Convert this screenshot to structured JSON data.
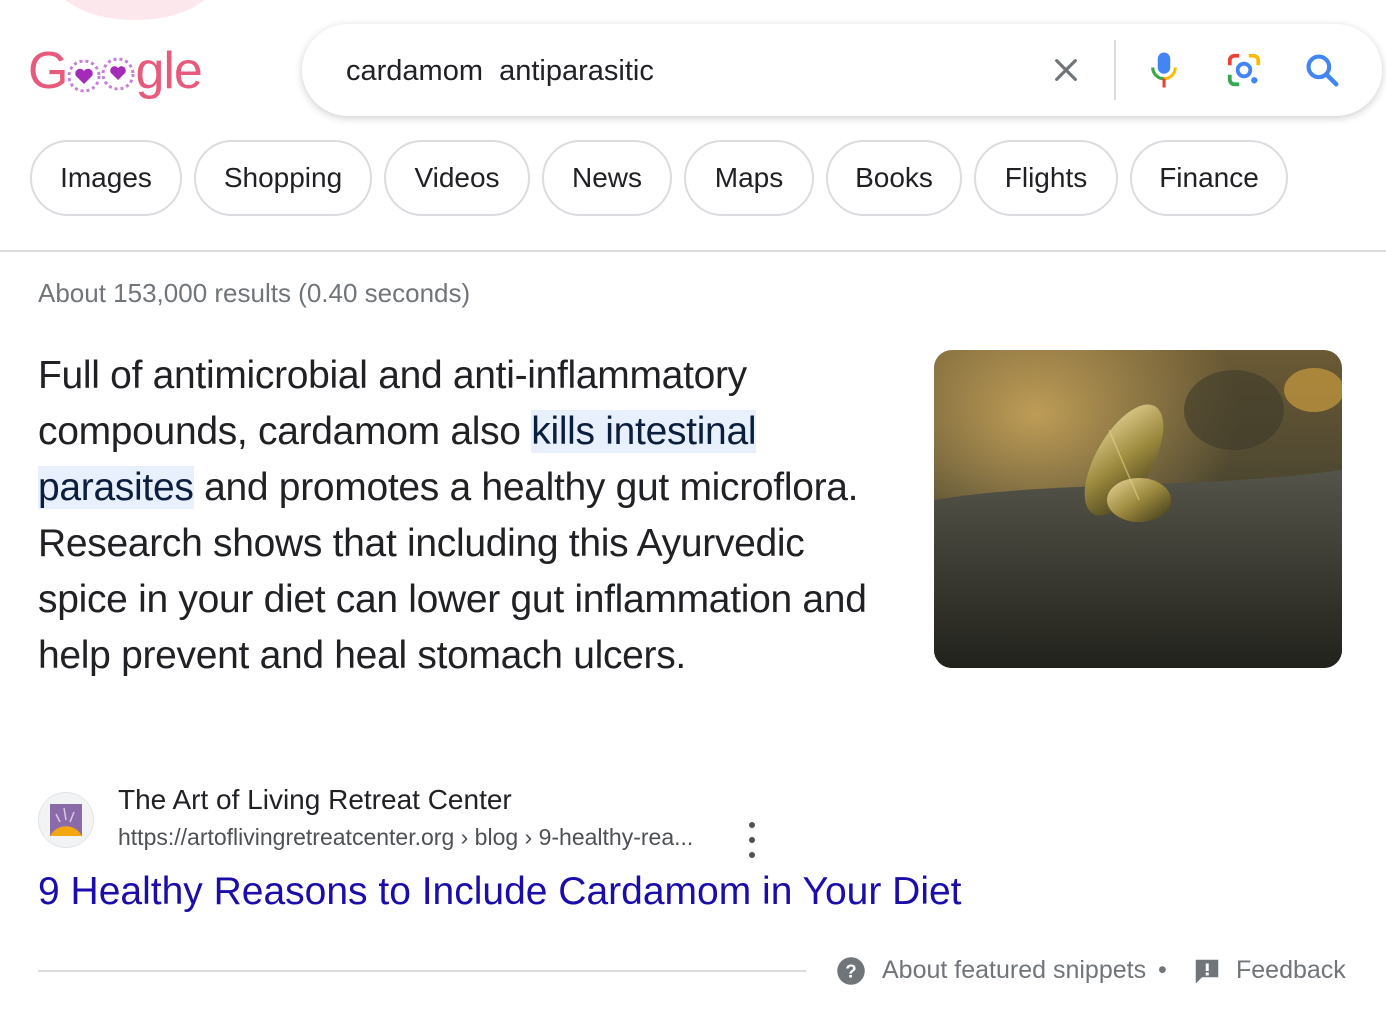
{
  "logo": {
    "text_g": "G",
    "text_rest": "gle",
    "brand_color": "#e85a7b"
  },
  "search": {
    "query": "cardamom  antiparasitic",
    "clear_icon": "close-icon",
    "mic_icon": "mic-icon",
    "lens_icon": "camera-lens-icon",
    "search_icon": "search-icon"
  },
  "tabs": [
    {
      "label": "Images"
    },
    {
      "label": "Shopping"
    },
    {
      "label": "Videos"
    },
    {
      "label": "News"
    },
    {
      "label": "Maps"
    },
    {
      "label": "Books"
    },
    {
      "label": "Flights"
    },
    {
      "label": "Finance"
    }
  ],
  "results_stats": "About 153,000 results (0.40 seconds)",
  "featured_snippet": {
    "text_before": "Full of antimicrobial and anti-inflammatory compounds, cardamom also ",
    "highlight": "kills intestinal parasites",
    "text_after": " and promotes a healthy gut microflora. Research shows that including this Ayurvedic spice in your diet can lower gut inflammation and help prevent and heal stomach ulcers.",
    "source_name": "The Art of Living Retreat Center",
    "source_url": "https://artoflivingretreatcenter.org › blog › 9-healthy-rea...",
    "result_title": "9 Healthy Reasons to Include Cardamom in Your Diet",
    "link_color": "#1a0dab",
    "highlight_color": "#e8f0fe"
  },
  "footer": {
    "about_label": "About featured snippets",
    "separator": "•",
    "feedback_label": "Feedback"
  }
}
